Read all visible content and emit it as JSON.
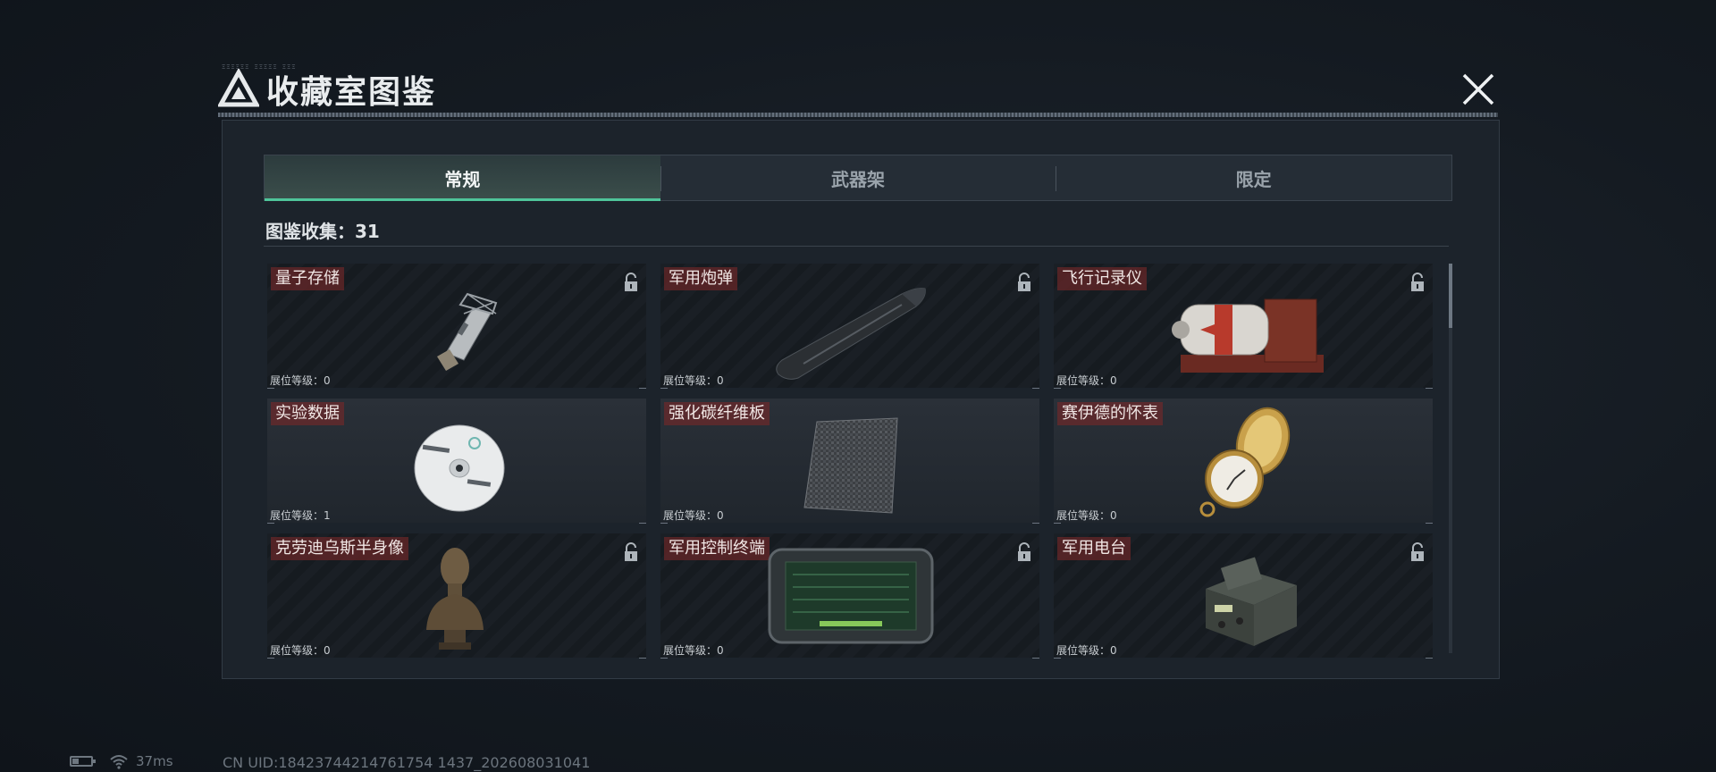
{
  "window": {
    "title": "收藏室图鉴",
    "small_caption": "ΞΞΞΞΞΞ ΞΞΞΞΞ ΞΞΞ"
  },
  "tabs": [
    {
      "label": "常规",
      "active": true
    },
    {
      "label": "武器架",
      "active": false
    },
    {
      "label": "限定",
      "active": false
    }
  ],
  "collection": {
    "label": "图鉴收集：31"
  },
  "level_label": "展位等级：",
  "items": [
    {
      "name": "量子存储",
      "level": "0",
      "locked": true,
      "icon": "usb-drive-icon"
    },
    {
      "name": "军用炮弹",
      "level": "0",
      "locked": true,
      "icon": "artillery-shell-icon"
    },
    {
      "name": "飞行记录仪",
      "level": "0",
      "locked": true,
      "icon": "flight-recorder-icon"
    },
    {
      "name": "实验数据",
      "level": "1",
      "locked": false,
      "icon": "compact-disc-icon"
    },
    {
      "name": "强化碳纤维板",
      "level": "0",
      "locked": false,
      "icon": "carbon-fiber-plate-icon"
    },
    {
      "name": "赛伊德的怀表",
      "level": "0",
      "locked": false,
      "icon": "pocket-watch-icon"
    },
    {
      "name": "克劳迪乌斯半身像",
      "level": "0",
      "locked": true,
      "icon": "bust-statue-icon"
    },
    {
      "name": "军用控制终端",
      "level": "0",
      "locked": true,
      "icon": "control-terminal-icon"
    },
    {
      "name": "军用电台",
      "level": "0",
      "locked": true,
      "icon": "military-radio-icon"
    }
  ],
  "status": {
    "ping": "37ms",
    "uid": "CN UID:18423744214761754 1437_202608031041",
    "battery_level": 0.35
  },
  "colors": {
    "accent": "#4fc59a",
    "name_tag": "#782828"
  }
}
